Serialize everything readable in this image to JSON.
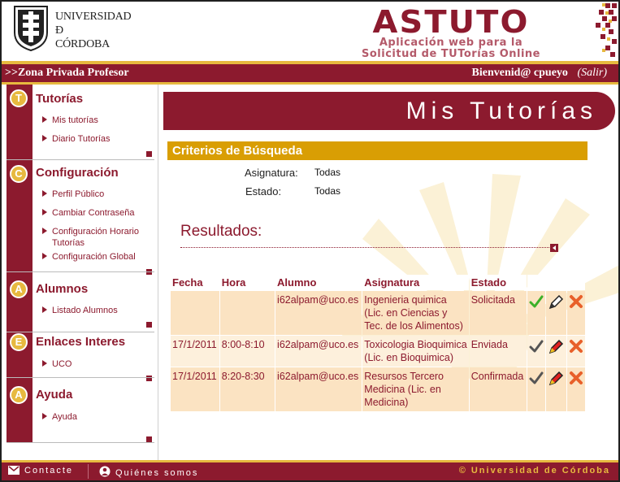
{
  "header": {
    "university_name": [
      "UNIVERSIDAD",
      "Ð",
      "CÓRDOBA"
    ],
    "app_title": "ASTUTO",
    "app_subtitle_1": "Aplicación web para la",
    "app_subtitle_2": "Solicitud de TUTorías Online"
  },
  "topbar": {
    "zone": ">>Zona Privada Profesor",
    "welcome": "Bienvenid@ cpueyo",
    "logout": "(Salir)"
  },
  "sidebar": {
    "sections": [
      {
        "badge": "T",
        "title": "Tutorías",
        "items": [
          "Mis tutorías",
          "Diario Tutorías"
        ]
      },
      {
        "badge": "C",
        "title": "Configuración",
        "items": [
          "Perfil Público",
          "Cambiar Contraseña",
          "Configuración Horario Tutorías",
          "Configuración Global"
        ]
      },
      {
        "badge": "A",
        "title": "Alumnos",
        "items": [
          "Listado Alumnos"
        ]
      },
      {
        "badge": "E",
        "title": "Enlaces Interes",
        "items": [
          "UCO"
        ]
      },
      {
        "badge": "A",
        "title": "Ayuda",
        "items": [
          "Ayuda"
        ]
      }
    ]
  },
  "main": {
    "page_title": "Mis Tutorías",
    "criteria_title": "Criterios de Búsqueda",
    "criteria": {
      "asignatura_label": "Asignatura:",
      "asignatura_value": "Todas",
      "estado_label": "Estado:",
      "estado_value": "Todas"
    },
    "results_title": "Resultados:",
    "table": {
      "headers": [
        "Fecha",
        "Hora",
        "Alumno",
        "Asignatura",
        "Estado"
      ],
      "rows": [
        {
          "fecha": "",
          "hora": "",
          "alumno": "i62alpam@uco.es",
          "asignatura": "Ingenieria quimica (Lic. en Ciencias y Tec. de los Alimentos)",
          "estado": "Solicitada"
        },
        {
          "fecha": "17/1/2011",
          "hora": "8:00-8:10",
          "alumno": "i62alpam@uco.es",
          "asignatura": "Toxicologia Bioquimica (Lic. en Bioquimica)",
          "estado": "Enviada"
        },
        {
          "fecha": "17/1/2011",
          "hora": "8:20-8:30",
          "alumno": "i62alpam@uco.es",
          "asignatura": "Resursos Tercero Medicina (Lic. en Medicina)",
          "estado": "Confirmada"
        }
      ]
    }
  },
  "footer": {
    "contact": "Contacte",
    "about": "Quiénes somos",
    "copyright": "© Universidad de Córdoba"
  },
  "colors": {
    "brand": "#8c1a2e",
    "gold": "#e7b93f",
    "criteria_bar": "#d99e04",
    "row_bg": "#fbe3c2"
  }
}
